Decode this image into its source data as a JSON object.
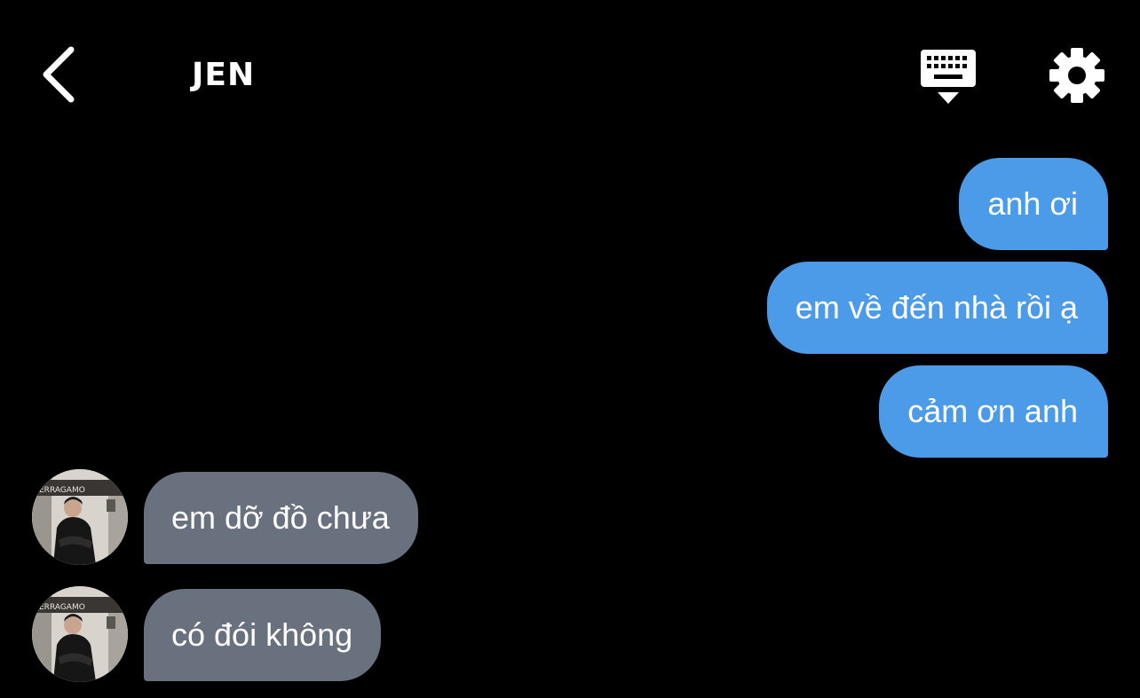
{
  "header": {
    "title": "JEN",
    "back_icon": "chevron-left-icon",
    "keyboard_icon": "keyboard-hide-icon",
    "settings_icon": "gear-icon"
  },
  "messages": [
    {
      "direction": "sent",
      "text": "anh ơi"
    },
    {
      "direction": "sent",
      "text": "em về đến nhà rồi ạ"
    },
    {
      "direction": "sent",
      "text": "cảm ơn anh"
    },
    {
      "direction": "received",
      "text": "em dỡ đồ chưa",
      "avatar_sign_text": "ERRAGAMO"
    },
    {
      "direction": "received",
      "text": "có đói không",
      "avatar_sign_text": "ERRAGAMO"
    }
  ],
  "colors": {
    "background": "#000000",
    "sent_bubble": "#4c9be8",
    "received_bubble": "#68717d",
    "text": "#ffffff"
  }
}
